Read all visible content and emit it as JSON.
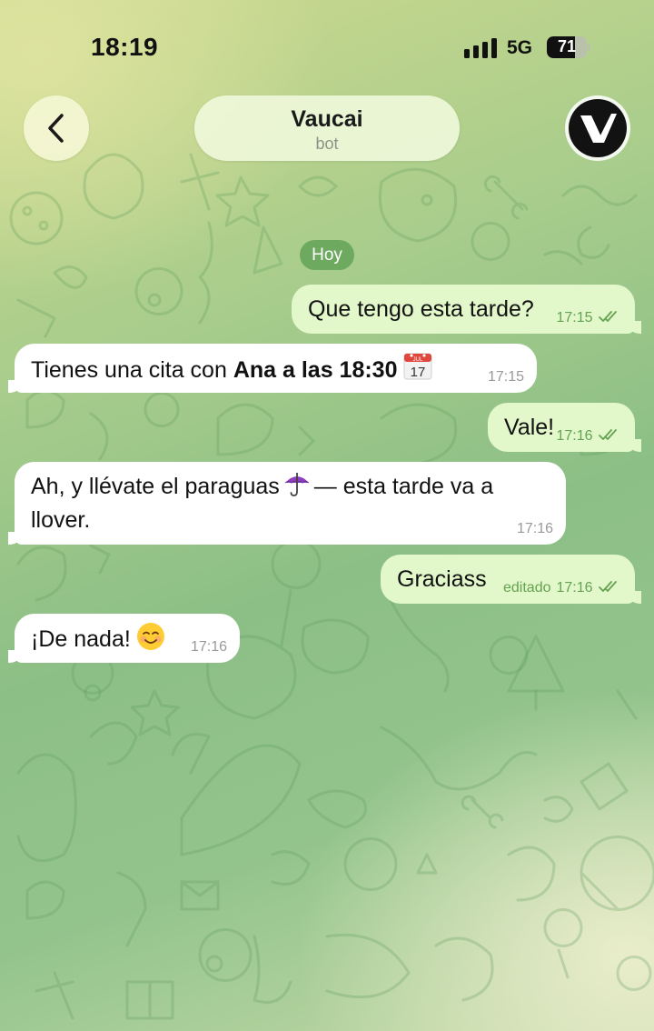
{
  "status_bar": {
    "time": "18:19",
    "network": "5G",
    "battery_level": "71",
    "battery_percent": 71
  },
  "header": {
    "back_icon": "chevron-left-icon",
    "title": "Vaucai",
    "subtitle": "bot",
    "avatar_icon": "vaucai-v-logo"
  },
  "date_chip": "Hoy",
  "calendar_emoji": {
    "month": "JUL",
    "day": "17"
  },
  "messages": [
    {
      "direction": "out",
      "text": "Que tengo esta tarde?",
      "time": "17:15",
      "status": "read"
    },
    {
      "direction": "in",
      "text_before": "Tienes una cita con ",
      "text_bold": "Ana a las 18:30",
      "emoji": "calendar-emoji",
      "time": "17:15"
    },
    {
      "direction": "out",
      "text": "Vale!",
      "time": "17:16",
      "status": "read"
    },
    {
      "direction": "in",
      "line1_before": "Ah, y llévate el paraguas",
      "emoji": "umbrella-emoji",
      "line1_after": "— esta tarde va a",
      "line2": "llover.",
      "time": "17:16"
    },
    {
      "direction": "out",
      "text": "Graciass",
      "edited_label": "editado",
      "time": "17:16",
      "status": "read"
    },
    {
      "direction": "in",
      "text": "¡De nada!",
      "emoji": "smiling-face-emoji",
      "time": "17:16"
    }
  ],
  "colors": {
    "outgoing_bubble": "#e2f7ca",
    "incoming_bubble": "#ffffff",
    "outgoing_meta": "#64a352",
    "date_chip": "#6ea960"
  }
}
